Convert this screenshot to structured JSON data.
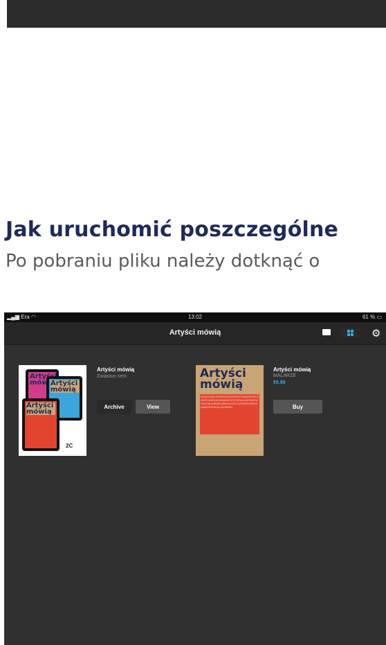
{
  "heading": "Jak uruchomić poszczególne",
  "subheading": "Po pobraniu pliku należy dotknąć o",
  "ipad": {
    "status": {
      "carrier": "Era",
      "time": "13:02",
      "battery": "61 %"
    },
    "nav": {
      "title": "Artyści mówią"
    },
    "items": [
      {
        "title": "Artyści mówią",
        "subtitle": "Zwiastun serii",
        "cover_title": "Artyści mówią",
        "buttons": {
          "archive": "Archive",
          "view": "View"
        }
      },
      {
        "title": "Artyści mówią",
        "subtitle": "MALARZE",
        "price": "€5.99",
        "cover_title": "Artyści mówią",
        "buttons": {
          "buy": "Buy"
        }
      }
    ],
    "colors": {
      "accent": "#36a9e1",
      "heading": "#1f2a5c",
      "cover_red": "#e3442f",
      "cover_tan": "#c9a575"
    }
  }
}
